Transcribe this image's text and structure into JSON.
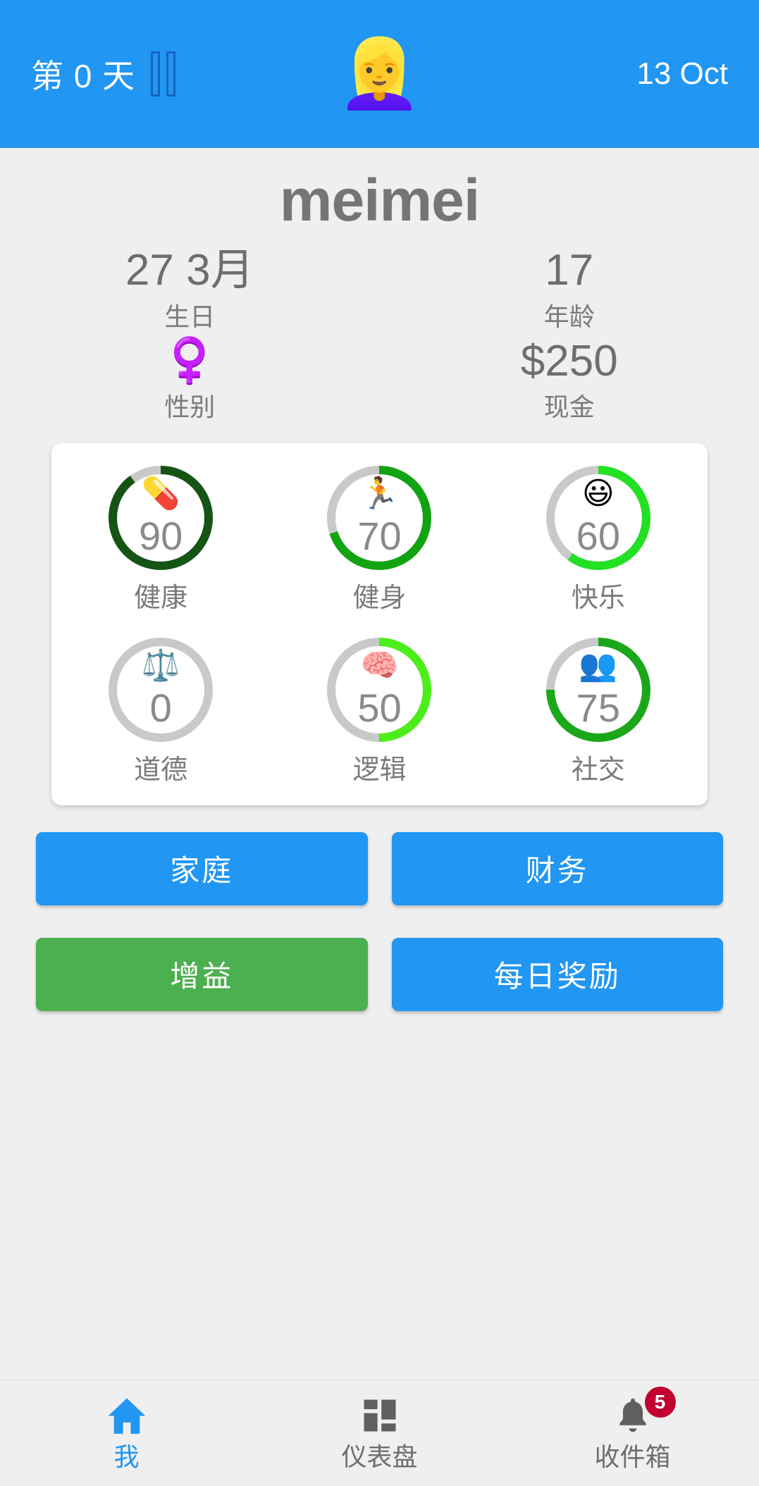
{
  "header": {
    "day_label": "第 0 天",
    "pause_icon": "pause-icon",
    "avatar_emoji": "👱‍♀️",
    "date_label": "13 Oct",
    "background_color": "#2196f3"
  },
  "profile": {
    "name": "meimei",
    "stats": [
      {
        "value": "27 3月",
        "label": "生日",
        "kind": "text",
        "name": "birthday"
      },
      {
        "value": "17",
        "label": "年龄",
        "kind": "text",
        "name": "age"
      },
      {
        "value": "♀️",
        "label": "性别",
        "kind": "icon",
        "name": "gender"
      },
      {
        "value": "$250",
        "label": "现金",
        "kind": "text",
        "name": "cash"
      }
    ]
  },
  "attributes": {
    "rows": [
      [
        {
          "key": "health",
          "label": "健康",
          "value": 90,
          "emoji": "💊",
          "color": "#155415",
          "track": "#c9c9c9"
        },
        {
          "key": "fitness",
          "label": "健身",
          "value": 70,
          "emoji": "🏃",
          "color": "#12a312",
          "track": "#c9c9c9"
        },
        {
          "key": "happy",
          "label": "快乐",
          "value": 60,
          "emoji": "😃",
          "color": "#22e022",
          "track": "#c9c9c9"
        }
      ],
      [
        {
          "key": "morality",
          "label": "道德",
          "value": 0,
          "emoji": "⚖️",
          "color": "#c9c9c9",
          "track": "#c9c9c9"
        },
        {
          "key": "logic",
          "label": "逻辑",
          "value": 50,
          "emoji": "🧠",
          "color": "#4bee19",
          "track": "#c9c9c9"
        },
        {
          "key": "social",
          "label": "社交",
          "value": 75,
          "emoji": "👥",
          "color": "#1aa81a",
          "track": "#c9c9c9"
        }
      ]
    ]
  },
  "actions": {
    "rows": [
      [
        {
          "key": "family",
          "label": "家庭",
          "style": "blue"
        },
        {
          "key": "finance",
          "label": "财务",
          "style": "blue"
        }
      ],
      [
        {
          "key": "buff",
          "label": "增益",
          "style": "green"
        },
        {
          "key": "daily_reward",
          "label": "每日奖励",
          "style": "blue"
        }
      ]
    ]
  },
  "bottom_nav": {
    "items": [
      {
        "key": "me",
        "label": "我",
        "icon": "home-icon",
        "active": true,
        "badge": null
      },
      {
        "key": "dashboard",
        "label": "仪表盘",
        "icon": "dashboard-icon",
        "active": false,
        "badge": null
      },
      {
        "key": "inbox",
        "label": "收件箱",
        "icon": "bell-icon",
        "active": false,
        "badge": "5"
      }
    ]
  },
  "colors": {
    "primary": "#2196f3",
    "green": "#4caf50",
    "badge": "#c2002f",
    "page_bg": "#efefef",
    "card_bg": "#ffffff",
    "muted_text": "#757575"
  }
}
